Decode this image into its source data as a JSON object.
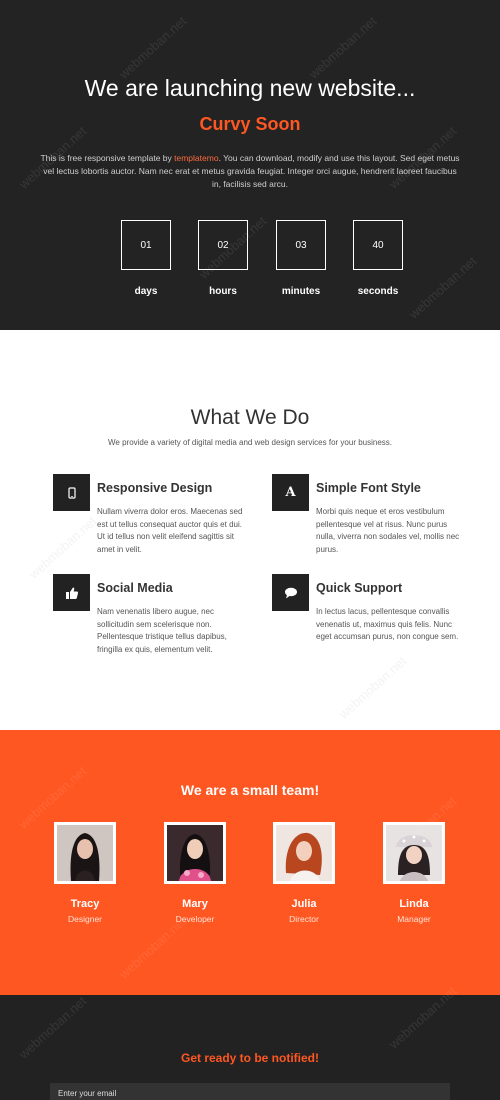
{
  "hero": {
    "title": "We are launching new website...",
    "brand": "Curvy Soon",
    "intro_before": "This is free responsive template by ",
    "intro_link": "templatemo",
    "intro_after": ". You can download, modify and use this layout. Sed eget metus vel lectus lobortis auctor. Nam nec erat et metus gravida feugiat. Integer orci augue, hendrerit laoreet faucibus in, facilisis sed arcu.",
    "countdown": [
      {
        "value": "01",
        "label": "days"
      },
      {
        "value": "02",
        "label": "hours"
      },
      {
        "value": "03",
        "label": "minutes"
      },
      {
        "value": "40",
        "label": "seconds"
      }
    ]
  },
  "services": {
    "title": "What We Do",
    "subtitle": "We provide a variety of digital media and web design services for your business.",
    "items": [
      {
        "icon": "mobile-icon",
        "title": "Responsive Design",
        "text": "Nullam viverra dolor eros. Maecenas sed est ut tellus consequat auctor quis et dui. Ut id tellus non velit eleifend sagittis sit amet in velit."
      },
      {
        "icon": "font-icon",
        "title": "Simple Font Style",
        "text": "Morbi quis neque et eros vestibulum pellentesque vel at risus. Nunc purus nulla, viverra non sodales vel, mollis nec purus."
      },
      {
        "icon": "thumbs-up-icon",
        "title": "Social Media",
        "text": "Nam venenatis libero augue, nec sollicitudin sem scelerisque non. Pellentesque tristique tellus dapibus, fringilla ex quis, elementum velit."
      },
      {
        "icon": "chat-bubble-icon",
        "title": "Quick Support",
        "text": "In lectus lacus, pellentesque convallis venenatis ut, maximus quis felis. Nunc eget accumsan purus, non congue sem."
      }
    ]
  },
  "team": {
    "title": "We are a small team!",
    "members": [
      {
        "name": "Tracy",
        "role": "Designer"
      },
      {
        "name": "Mary",
        "role": "Developer"
      },
      {
        "name": "Julia",
        "role": "Director"
      },
      {
        "name": "Linda",
        "role": "Manager"
      }
    ]
  },
  "notify": {
    "title": "Get ready to be notified!",
    "email_placeholder": "Enter your email"
  },
  "watermark": "webmoban.net",
  "colors": {
    "accent": "#ff5722",
    "dark": "#232323",
    "light": "#ffffff"
  }
}
